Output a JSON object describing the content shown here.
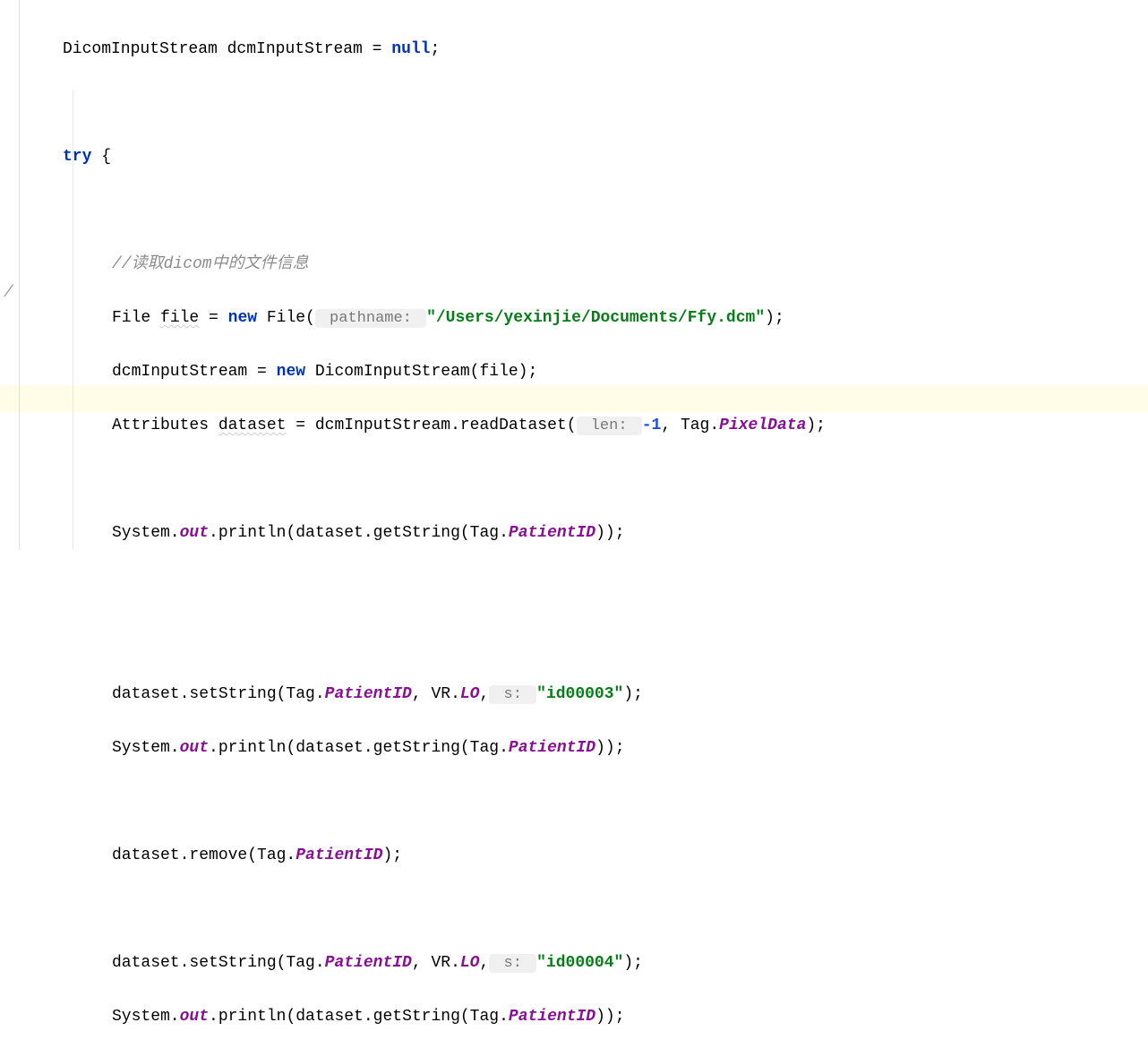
{
  "gutterMark": "/",
  "code": {
    "l1": {
      "t1": "DicomInputStream dcmInputStream = ",
      "kw": "null",
      "t2": ";"
    },
    "l2": {
      "kw": "try",
      "t": " {"
    },
    "l3": {
      "comment": "//读取dicom中的文件信息"
    },
    "l4": {
      "t1": "File ",
      "wavy": "file",
      "t2": " = ",
      "kw": "new",
      "t3": " File(",
      "hint": " pathname: ",
      "str": "\"/Users/yexinjie/Documents/Ffy.dcm\"",
      "t4": ");"
    },
    "l5": {
      "t1": "dcmInputStream = ",
      "kw": "new",
      "t2": " DicomInputStream(file);"
    },
    "l6": {
      "t1": "Attributes ",
      "wavy": "dataset",
      "t2": " = dcmInputStream.readDataset(",
      "hint": " len: ",
      "num": "-1",
      "t3": ", Tag.",
      "field": "PixelData",
      "t4": ");"
    },
    "l7": {
      "t1": "System.",
      "field1": "out",
      "t2": ".println(dataset.getString(Tag.",
      "field2": "PatientID",
      "t3": "));"
    },
    "l8": {
      "t1": "dataset.setString(Tag.",
      "field1": "PatientID",
      "t2": ", VR.",
      "field2": "LO",
      "t3": ",",
      "hint": " s: ",
      "str": "\"id00003\"",
      "t4": ");"
    },
    "l9": {
      "t1": "System.",
      "field1": "out",
      "t2": ".println(dataset.getString(Tag.",
      "field2": "PatientID",
      "t3": "));"
    },
    "l10": {
      "t1": "dataset.remove(Tag.",
      "field": "PatientID",
      "t2": ");"
    },
    "l11": {
      "t1": "dataset.setString(Tag.",
      "field1": "PatientID",
      "t2": ", VR.",
      "field2": "LO",
      "t3": ",",
      "hint": " s: ",
      "str": "\"id00004\"",
      "t4": ");"
    },
    "l12": {
      "t1": "System.",
      "field1": "out",
      "t2": ".println(dataset.getString(Tag.",
      "field2": "PatientID",
      "t3": "));"
    }
  }
}
